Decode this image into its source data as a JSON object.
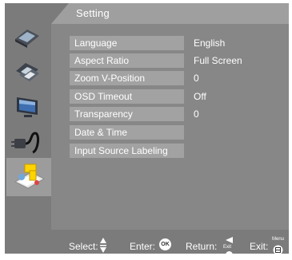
{
  "title": "Setting",
  "icons": [
    {
      "name": "picture-icon"
    },
    {
      "name": "color-icon"
    },
    {
      "name": "monitor-icon"
    },
    {
      "name": "audio-plug-icon"
    },
    {
      "name": "setting-icon",
      "selected": true
    }
  ],
  "menu": [
    {
      "label": "Language",
      "value": "English"
    },
    {
      "label": "Aspect Ratio",
      "value": "Full Screen"
    },
    {
      "label": "Zoom V-Position",
      "value": "0"
    },
    {
      "label": "OSD Timeout",
      "value": "Off"
    },
    {
      "label": "Transparency",
      "value": "0"
    },
    {
      "label": "Date & Time",
      "value": ""
    },
    {
      "label": "Input Source Labeling",
      "value": ""
    }
  ],
  "footer": {
    "select": "Select:",
    "enter": "Enter:",
    "enter_key": "OK",
    "return": "Return:",
    "return_key": "Exit",
    "exit": "Exit:",
    "exit_key": "Menu"
  },
  "colors": {
    "panel": "#878787",
    "sidebar": "#7b7b7b",
    "item": "#a2a2a2",
    "text": "#ffffff"
  }
}
